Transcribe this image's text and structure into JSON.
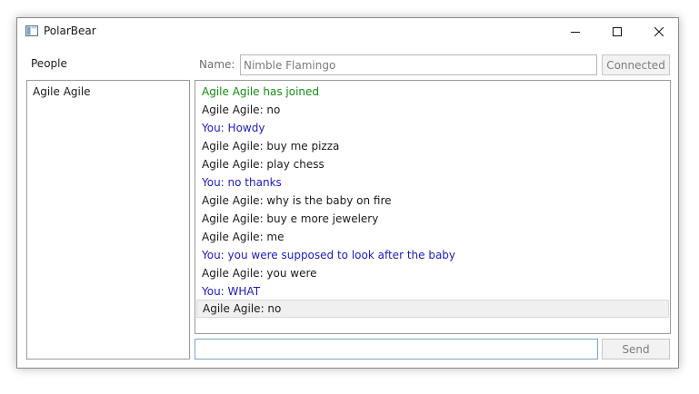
{
  "window": {
    "title": "PolarBear",
    "icons": {
      "app": "window-app-icon",
      "minimize": "minimize-icon",
      "maximize": "maximize-icon",
      "close": "close-icon"
    }
  },
  "people": {
    "label": "People",
    "items": [
      "Agile Agile"
    ]
  },
  "connection": {
    "name_label": "Name:",
    "name_value": "Nimble Flamingo",
    "connect_button": "Connected"
  },
  "chat": {
    "messages": [
      {
        "kind": "system",
        "text": "Agile Agile has joined"
      },
      {
        "kind": "other",
        "text": "Agile Agile: no"
      },
      {
        "kind": "self",
        "text": "You: Howdy"
      },
      {
        "kind": "other",
        "text": "Agile Agile: buy me pizza"
      },
      {
        "kind": "other",
        "text": "Agile Agile: play chess"
      },
      {
        "kind": "self",
        "text": "You: no thanks"
      },
      {
        "kind": "other",
        "text": "Agile Agile: why is the baby on fire"
      },
      {
        "kind": "other",
        "text": "Agile Agile: buy e more jewelery"
      },
      {
        "kind": "other",
        "text": "Agile Agile: me"
      },
      {
        "kind": "self",
        "text": "You: you were supposed to look after the baby"
      },
      {
        "kind": "other",
        "text": "Agile Agile: you were"
      },
      {
        "kind": "self",
        "text": "You: WHAT"
      },
      {
        "kind": "other",
        "text": "Agile Agile: no",
        "selected": true
      }
    ],
    "colors": {
      "system": "#178917",
      "other": "#1a1a1a",
      "self": "#1d1db3"
    }
  },
  "composer": {
    "message_value": "",
    "send_button": "Send"
  }
}
